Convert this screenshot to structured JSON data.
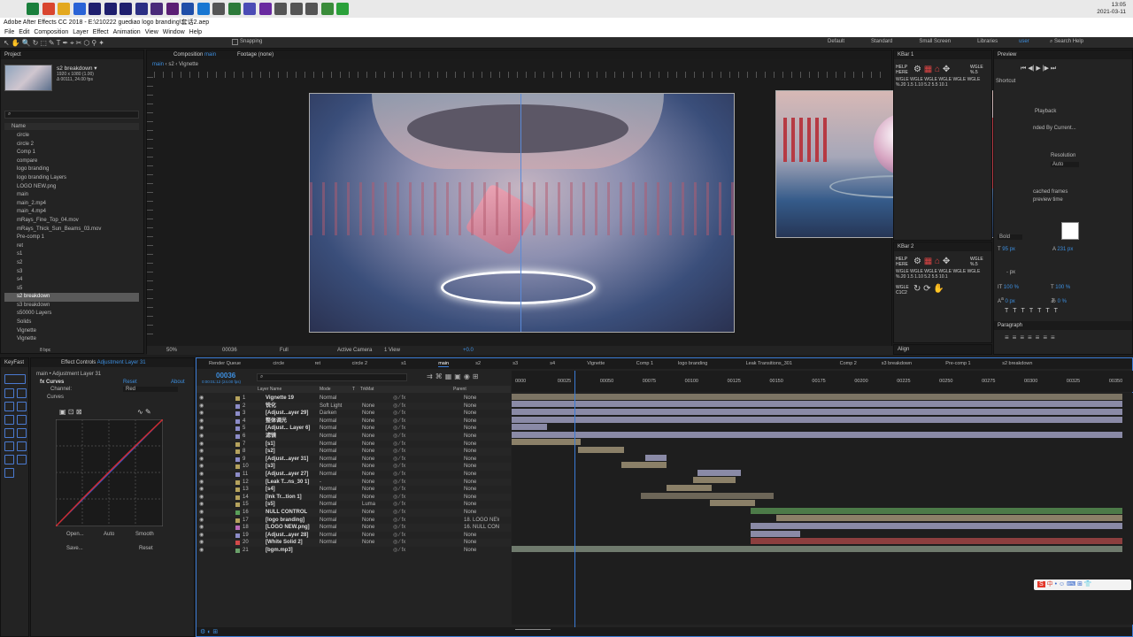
{
  "taskbar": {
    "time": "13:05",
    "date": "2021-03-11",
    "icon_colors": [
      "#1a7f3c",
      "#d9452f",
      "#e3a81f",
      "#2a63d6",
      "#1f1f6e",
      "#1f1f6e",
      "#1f1f6e",
      "#2b2f84",
      "#4a2a7a",
      "#5a1e74",
      "#1f4ea8",
      "#1977d2",
      "#555555",
      "#2d7a3a",
      "#4b4bb5",
      "#6a2aa0",
      "#555555",
      "#555555",
      "#555555",
      "#3a8c3a",
      "#2ba13a"
    ]
  },
  "window": {
    "title": "Adobe After Effects CC 2018 - E:\\210222 guediao logo branding\\套话2.aep"
  },
  "menu": [
    "File",
    "Edit",
    "Composition",
    "Layer",
    "Effect",
    "Animation",
    "View",
    "Window",
    "Help"
  ],
  "toolbar": {
    "snapping": "Snapping",
    "workspaces": [
      "Default",
      "Standard",
      "Small Screen",
      "Libraries",
      "user"
    ],
    "search": "Search Help"
  },
  "project": {
    "tab": "Project",
    "comp_name": "s2 breakdown ▾",
    "comp_info1": "1920 x 1080 (1.00)",
    "comp_info2": "Δ 00111, 24.00 fps",
    "col_name": "Name",
    "bpc": "8 bpc",
    "items": [
      "circle",
      "circle 2",
      "Comp 1",
      "compare",
      "logo branding",
      "logo branding Layers",
      "LOGO NEW.png",
      "main",
      "main_2.mp4",
      "main_4.mp4",
      "mRays_Fine_Top_04.mov",
      "mRays_Thick_Sun_Beams_03.mov",
      "Pre-comp 1",
      "ret",
      "s1",
      "s2",
      "s3",
      "s4",
      "s5",
      "s2 breakdown",
      "s3 breakdown",
      "s50000 Layers",
      "Solids",
      "Vignette",
      "Vignette"
    ]
  },
  "comp": {
    "tab_label": "Composition",
    "tab_comp": "main",
    "footage": "Footage (none)",
    "crumbs": [
      "main",
      "s2",
      "Vignette"
    ],
    "zoom": "50%",
    "timecode": "00036",
    "quality": "Full",
    "camera": "Active Camera",
    "view": "1 View",
    "exposure": "+0.0"
  },
  "kbar1": {
    "tab": "KBar 1",
    "help": "HELP HERE",
    "wgle": "WGLE %.5",
    "vals": "WGLE WGLE WGLE WGLE WGLE WGLE %.20 1.5 1.10 5.2 5.5 10.1"
  },
  "kbar2": {
    "tab": "KBar 2",
    "help": "HELP HERE",
    "wgle": "WGLE %.5",
    "vals": "WGLE WGLE WGLE WGLE WGLE WGLE %.20 1.5 1.10 5.2 5.5 10.1",
    "wgle2": "WGLE C1C2"
  },
  "align": {
    "tab": "Align"
  },
  "preview": {
    "tab": "Preview",
    "shortcut": "Shortcut",
    "playback": "Playback",
    "ended": "nded By Current...",
    "resolution": "Resolution",
    "auto": "Auto",
    "cached": "cached frames",
    "preview_time": "preview time"
  },
  "character": {
    "bold": "Bold",
    "size": "95 px",
    "leading": "231 px",
    "tracking": "- px",
    "scale_v": "100 %",
    "scale_h": "100 %",
    "baseline": "0 px",
    "tsume": "0 %"
  },
  "paragraph": {
    "tab": "Paragraph"
  },
  "effects": {
    "tab_left": "KeyFast",
    "tab": "Effect Controls",
    "tab_target": "Adjustment Layer 31",
    "path": "main • Adjustment Layer 31",
    "fx_name": "Curves",
    "reset": "Reset",
    "about": "About",
    "channel_label": "Channel:",
    "channel_value": "Red",
    "curves_label": "Curves",
    "open": "Open...",
    "auto": "Auto",
    "smooth": "Smooth",
    "save": "Save...",
    "reset2": "Reset"
  },
  "timeline": {
    "tabs": [
      "Render Queue",
      "circle",
      "ret",
      "circle 2",
      "s1",
      "main",
      "s2",
      "s3",
      "s4",
      "Vignette",
      "Comp 1",
      "logo branding",
      "Leak Transitions_301",
      "Comp 2",
      "s3 breakdown",
      "Pre-comp 1",
      "s2 breakdown"
    ],
    "active_tab": "main",
    "timecode": "00036",
    "timecode_sub": "0:00:01:12 (24.00 fps)",
    "headers": {
      "name": "Layer Name",
      "mode": "Mode",
      "t": "T",
      "trkmat": "TrkMat",
      "parent": "Parent"
    },
    "ticks": [
      "0000",
      "00025",
      "00050",
      "00075",
      "00100",
      "00125",
      "00150",
      "00175",
      "00200",
      "00225",
      "00250",
      "00275",
      "00300",
      "00325",
      "00350"
    ],
    "ime": "中"
  },
  "layers": [
    {
      "num": "1",
      "name": "Vignette 19",
      "mode": "Normal",
      "trk": "",
      "parent": "None",
      "color": "#b5a25d",
      "bar": [
        0,
        1280
      ],
      "barcolor": "#7c7464"
    },
    {
      "num": "2",
      "name": "锐化",
      "mode": "Soft Light",
      "trk": "None",
      "parent": "None",
      "color": "#8c8cc8",
      "bar": [
        0,
        1280
      ],
      "barcolor": "#8a8aa6"
    },
    {
      "num": "3",
      "name": "[Adjust...ayer 29]",
      "mode": "Darken",
      "trk": "None",
      "parent": "None",
      "color": "#8c8cc8",
      "bar": [
        0,
        1280
      ],
      "barcolor": "#8a8aa6"
    },
    {
      "num": "4",
      "name": "整体调光",
      "mode": "Normal",
      "trk": "None",
      "parent": "None",
      "color": "#8c8cc8",
      "bar": [
        0,
        1280
      ],
      "barcolor": "#8a8aa6"
    },
    {
      "num": "5",
      "name": "[Adjust... Layer 6]",
      "mode": "Normal",
      "trk": "None",
      "parent": "None",
      "color": "#8c8cc8",
      "bar": [
        0,
        75
      ],
      "barcolor": "#8a8aa6"
    },
    {
      "num": "6",
      "name": "滤镜",
      "mode": "Normal",
      "trk": "None",
      "parent": "None",
      "color": "#8c8cc8",
      "bar": [
        0,
        1280
      ],
      "barcolor": "#8a8aa6"
    },
    {
      "num": "7",
      "name": "[s1]",
      "mode": "Normal",
      "trk": "None",
      "parent": "None",
      "color": "#b5a25d",
      "bar": [
        0,
        145
      ],
      "barcolor": "#8b8068"
    },
    {
      "num": "8",
      "name": "[s2]",
      "mode": "Normal",
      "trk": "None",
      "parent": "None",
      "color": "#b5a25d",
      "bar": [
        140,
        235
      ],
      "barcolor": "#8b8068"
    },
    {
      "num": "9",
      "name": "[Adjust...ayer 31]",
      "mode": "Normal",
      "trk": "None",
      "parent": "None",
      "color": "#8c8cc8",
      "bar": [
        280,
        325
      ],
      "barcolor": "#8a8aa6"
    },
    {
      "num": "10",
      "name": "[s3]",
      "mode": "Normal",
      "trk": "None",
      "parent": "None",
      "color": "#b5a25d",
      "bar": [
        230,
        325
      ],
      "barcolor": "#8b8068"
    },
    {
      "num": "11",
      "name": "[Adjust...ayer 27]",
      "mode": "Normal",
      "trk": "None",
      "parent": "None",
      "color": "#8c8cc8",
      "bar": [
        390,
        480
      ],
      "barcolor": "#8a8aa6"
    },
    {
      "num": "12",
      "name": "[Leak T...ns_30 1]",
      "mode": "-",
      "trk": "None",
      "parent": "None",
      "color": "#b5a25d",
      "bar": [
        380,
        470
      ],
      "barcolor": "#8b8068"
    },
    {
      "num": "13",
      "name": "[s4]",
      "mode": "Normal",
      "trk": "None",
      "parent": "None",
      "color": "#b5a25d",
      "bar": [
        325,
        420
      ],
      "barcolor": "#8b8068"
    },
    {
      "num": "14",
      "name": "[Ink Tr...tion 1]",
      "mode": "Normal",
      "trk": "None",
      "parent": "None",
      "color": "#b5a25d",
      "bar": [
        270,
        550
      ],
      "barcolor": "#6d6658"
    },
    {
      "num": "15",
      "name": "[s5]",
      "mode": "Normal",
      "trk": "Luma",
      "parent": "None",
      "color": "#b5a25d",
      "bar": [
        415,
        510
      ],
      "barcolor": "#8b8068"
    },
    {
      "num": "16",
      "name": "NULL CONTROL",
      "mode": "Normal",
      "trk": "None",
      "parent": "None",
      "color": "#5aa05a",
      "bar": [
        500,
        1280
      ],
      "barcolor": "#4c7a48"
    },
    {
      "num": "17",
      "name": "[logo branding]",
      "mode": "Normal",
      "trk": "None",
      "parent": "18. LOGO NEW",
      "color": "#b5a25d",
      "bar": [
        555,
        1280
      ],
      "barcolor": "#8b8068"
    },
    {
      "num": "18",
      "name": "[LOGO NEW.png]",
      "mode": "Normal",
      "trk": "None",
      "parent": "16. NULL CON",
      "color": "#b96ab9",
      "bar": [
        500,
        1280
      ],
      "barcolor": "#8a8aa6"
    },
    {
      "num": "19",
      "name": "[Adjust...ayer 28]",
      "mode": "Normal",
      "trk": "None",
      "parent": "None",
      "color": "#8c8cc8",
      "bar": [
        500,
        605
      ],
      "barcolor": "#8a8aa6"
    },
    {
      "num": "20",
      "name": "[White Solid 2]",
      "mode": "Normal",
      "trk": "None",
      "parent": "None",
      "color": "#d24a4a",
      "bar": [
        500,
        1280
      ],
      "barcolor": "#8c3e3e"
    },
    {
      "num": "21",
      "name": "[bgm.mp3]",
      "mode": "",
      "trk": "",
      "parent": "None",
      "color": "#6aa06a",
      "bar": [
        0,
        1280
      ],
      "barcolor": "#6f7a6d"
    }
  ]
}
